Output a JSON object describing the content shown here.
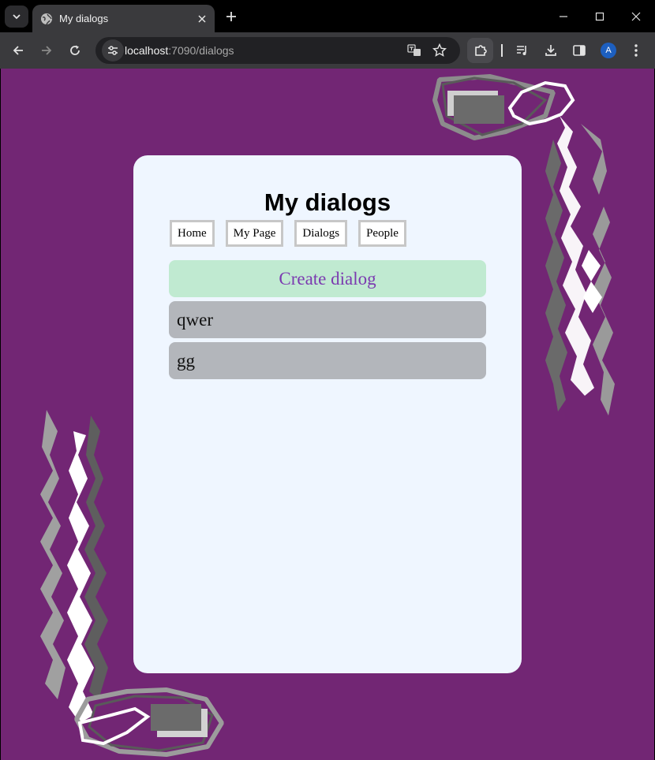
{
  "browser": {
    "tab": {
      "title": "My dialogs",
      "favicon": "globe-icon"
    },
    "address": {
      "host": "localhost",
      "rest": ":7090/dialogs"
    },
    "profile_initial": "A"
  },
  "page": {
    "title": "My dialogs",
    "nav": [
      "Home",
      "My Page",
      "Dialogs",
      "People"
    ],
    "create_label": "Create dialog",
    "dialogs": [
      "qwer",
      "gg"
    ]
  },
  "colors": {
    "background": "#722674",
    "card": "#eff6ff",
    "create_button": "#c0ead1",
    "create_text": "#7b3ab0",
    "dialog_item": "#b3b6bb"
  }
}
